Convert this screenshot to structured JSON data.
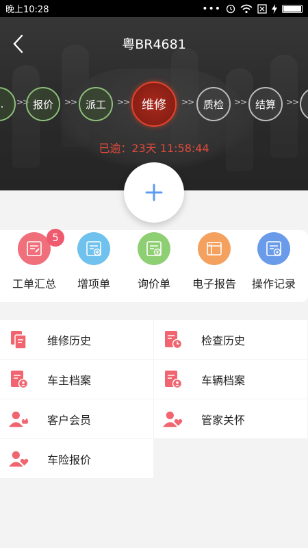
{
  "status_bar": {
    "time": "晚上10:28",
    "dots": "•••"
  },
  "header": {
    "title": "粤BR4681"
  },
  "workflow": {
    "steps": [
      {
        "label": "…",
        "state": "done"
      },
      {
        "label": "报价",
        "state": "done"
      },
      {
        "label": "派工",
        "state": "done"
      },
      {
        "label": "维修",
        "state": "current"
      },
      {
        "label": "质检",
        "state": "future"
      },
      {
        "label": "结算",
        "state": "future"
      },
      {
        "label": "",
        "state": "future"
      }
    ],
    "arrow": ">>"
  },
  "overdue": "已逾：23天  11:58:44",
  "quick_actions": [
    {
      "label": "工单汇总",
      "icon": "work-order-summary-icon",
      "color": "#ef6f7a",
      "badge": "5"
    },
    {
      "label": "增项单",
      "icon": "add-item-icon",
      "color": "#6fc1ee"
    },
    {
      "label": "询价单",
      "icon": "inquiry-icon",
      "color": "#8fcf73"
    },
    {
      "label": "电子报告",
      "icon": "e-report-icon",
      "color": "#f4a15f"
    },
    {
      "label": "操作记录",
      "icon": "operation-log-icon",
      "color": "#6a9bea"
    }
  ],
  "menu": [
    {
      "label": "维修历史",
      "icon": "repair-history-icon"
    },
    {
      "label": "检查历史",
      "icon": "inspection-history-icon"
    },
    {
      "label": "车主档案",
      "icon": "owner-profile-icon"
    },
    {
      "label": "车辆档案",
      "icon": "vehicle-profile-icon"
    },
    {
      "label": "客户会员",
      "icon": "customer-member-icon"
    },
    {
      "label": "管家关怀",
      "icon": "butler-care-icon"
    },
    {
      "label": "车险报价",
      "icon": "insurance-quote-icon"
    }
  ],
  "colors": {
    "menu_icon": "#f0656f",
    "plus": "#5b9cf0",
    "overdue": "#e24b3b"
  }
}
